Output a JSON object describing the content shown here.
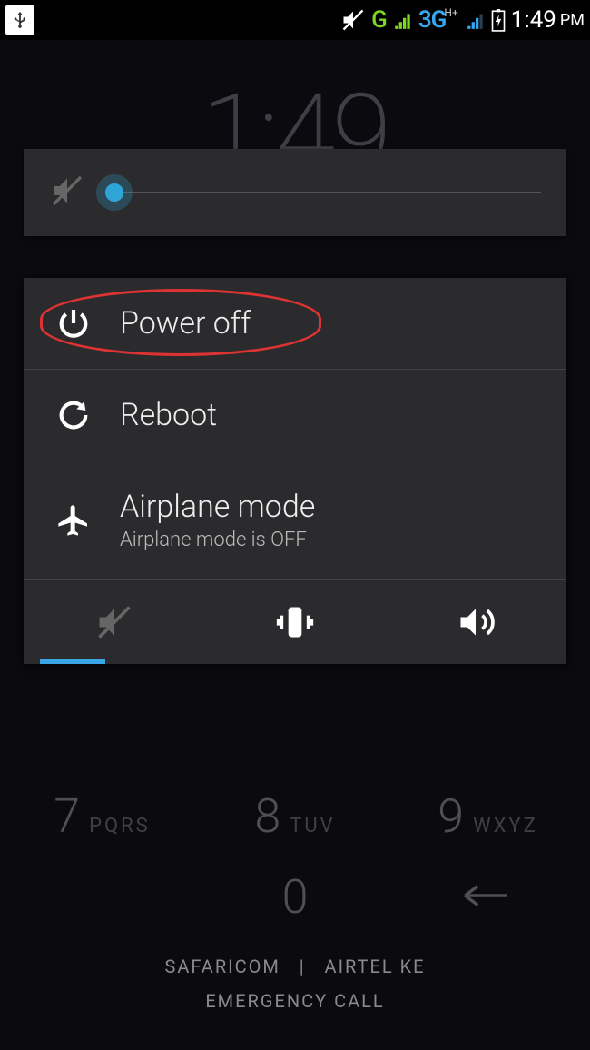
{
  "statusbar": {
    "g_label": "G",
    "net_label": "3G",
    "net_superscript": "H+",
    "time": "1:49",
    "ampm": "PM"
  },
  "clock": {
    "time": "1:49"
  },
  "volume": {
    "level_percent": 4
  },
  "power_menu": {
    "power_off": {
      "label": "Power off"
    },
    "reboot": {
      "label": "Reboot"
    },
    "airplane": {
      "label": "Airplane mode",
      "sub": "Airplane mode is OFF"
    },
    "sound_mode_active": "silent"
  },
  "keypad": {
    "row3": [
      {
        "digit": "7",
        "letters": "PQRS"
      },
      {
        "digit": "8",
        "letters": "TUV"
      },
      {
        "digit": "9",
        "letters": "WXYZ"
      }
    ],
    "row4_zero": "0",
    "carrier_left": "SAFARICOM",
    "carrier_sep": "|",
    "carrier_right": "AIRTEL KE",
    "emergency": "EMERGENCY CALL"
  },
  "annotation": {
    "circled_item": "power_off"
  }
}
